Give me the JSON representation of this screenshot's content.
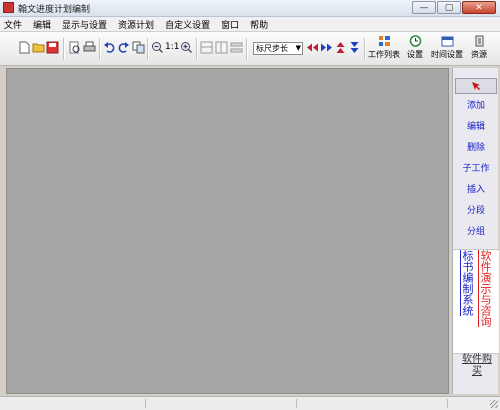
{
  "window": {
    "title": "翰文进度计划编制",
    "buttons": {
      "minimize": "—",
      "maximize": "▢",
      "close": "✕"
    }
  },
  "menu": [
    "文件",
    "编辑",
    "显示与设置",
    "资源计划",
    "自定义设置",
    "窗口",
    "帮助"
  ],
  "toolbar": {
    "zoom_actual_label": "1:1",
    "step_select": {
      "value": "标尺步长"
    },
    "big_buttons": {
      "task_list": "工作列表",
      "settings": "设置",
      "time_settings": "时间设置",
      "resource": "资源"
    },
    "icons": [
      "new-icon",
      "open-icon",
      "save-icon",
      "print-preview-icon",
      "print-icon",
      "undo-icon",
      "redo-icon",
      "copy-icon",
      "zoom-out-icon",
      "zoom-in-icon",
      "layout-a-icon",
      "layout-b-icon",
      "layout-c-icon",
      "step-left-icon",
      "step-right-icon",
      "step-up-icon",
      "step-down-icon"
    ]
  },
  "side_panel": {
    "pointer_icon": "cursor-icon",
    "buttons": [
      "添加",
      "编辑",
      "删除",
      "子工作",
      "插入",
      "分段",
      "分组"
    ],
    "link_left": "标书编制系统",
    "link_right": "软件演示与咨询",
    "buy": "软件购买"
  },
  "colors": {
    "canvas": "#a6a6a6",
    "link_blue": "#1a22c8",
    "link_red": "#e02020"
  }
}
